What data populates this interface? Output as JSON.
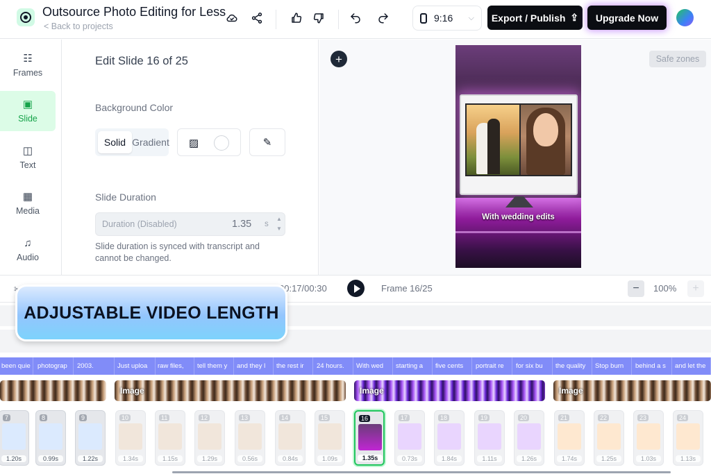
{
  "header": {
    "project_title": "Outsource Photo Editing for Less",
    "back_link": "< Back to projects",
    "aspect_ratio": "9:16",
    "export_label": "Export / Publish",
    "upgrade_label": "Upgrade Now",
    "icons": [
      "cloud-check-icon",
      "share-icon",
      "thumbs-up-icon",
      "thumbs-down-icon",
      "undo-icon",
      "redo-icon"
    ]
  },
  "rail": {
    "items": [
      {
        "label": "Frames",
        "icon": "layers-icon"
      },
      {
        "label": "Slide",
        "icon": "slide-icon",
        "active": true
      },
      {
        "label": "Text",
        "icon": "text-icon"
      },
      {
        "label": "Media",
        "icon": "image-icon"
      },
      {
        "label": "Audio",
        "icon": "music-note-icon"
      }
    ]
  },
  "panel": {
    "title": "Edit Slide 16 of 25",
    "background_label": "Background Color",
    "solid_label": "Solid",
    "gradient_label": "Gradient",
    "duration_label": "Slide Duration",
    "duration_placeholder": "Duration (Disabled)",
    "duration_value": "1.35",
    "duration_unit": "s",
    "duration_note": "Slide duration is synced with transcript and cannot be changed."
  },
  "canvas": {
    "safe_zones_label": "Safe zones",
    "caption": "With wedding edits"
  },
  "playback": {
    "timecode": "00:17/00:30",
    "frame_label": "Frame 16/25",
    "zoom": "100%"
  },
  "promo": {
    "text": "ADJUSTABLE VIDEO LENGTH"
  },
  "captions": [
    "been quie",
    "photograp",
    "2003.",
    "Just uploa",
    "raw files,",
    "tell them y",
    "and they l",
    "the rest ir",
    "24 hours.",
    "With wed",
    "starting a",
    "five cents",
    "portrait re",
    "for six bu",
    "the quality",
    "Stop burn",
    "behind a s",
    "and let the"
  ],
  "clips": [
    {
      "label": ""
    },
    {
      "label": "Image"
    },
    {
      "label": "Image"
    },
    {
      "label": "Image"
    }
  ],
  "frames": [
    {
      "num": "7",
      "dur": "1.20s"
    },
    {
      "num": "8",
      "dur": "0.99s"
    },
    {
      "num": "9",
      "dur": "1.22s"
    },
    {
      "num": "10",
      "dur": "1.34s"
    },
    {
      "num": "11",
      "dur": "1.15s"
    },
    {
      "num": "12",
      "dur": "1.29s"
    },
    {
      "num": "13",
      "dur": "0.56s"
    },
    {
      "num": "14",
      "dur": "0.84s"
    },
    {
      "num": "15",
      "dur": "1.09s"
    },
    {
      "num": "16",
      "dur": "1.35s",
      "active": true
    },
    {
      "num": "17",
      "dur": "0.73s"
    },
    {
      "num": "18",
      "dur": "1.84s"
    },
    {
      "num": "19",
      "dur": "1.11s"
    },
    {
      "num": "20",
      "dur": "1.26s"
    },
    {
      "num": "21",
      "dur": "1.74s"
    },
    {
      "num": "22",
      "dur": "1.25s"
    },
    {
      "num": "23",
      "dur": "1.03s"
    },
    {
      "num": "24",
      "dur": "1.13s"
    }
  ]
}
